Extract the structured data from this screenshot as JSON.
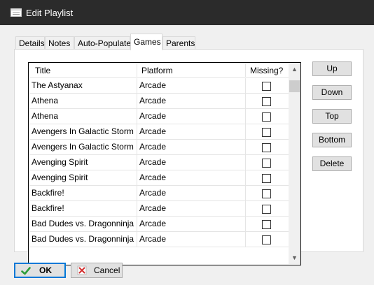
{
  "window": {
    "title": "Edit Playlist"
  },
  "tabs": [
    {
      "label": "Details"
    },
    {
      "label": "Notes"
    },
    {
      "label": "Auto-Populate"
    },
    {
      "label": "Games"
    },
    {
      "label": "Parents"
    }
  ],
  "active_tab": "Games",
  "games_table": {
    "columns": [
      "Title",
      "Platform",
      "Missing?"
    ],
    "rows": [
      {
        "title": "The Astyanax",
        "platform": "Arcade",
        "missing": false
      },
      {
        "title": "Athena",
        "platform": "Arcade",
        "missing": false
      },
      {
        "title": "Athena",
        "platform": "Arcade",
        "missing": false
      },
      {
        "title": "Avengers In Galactic Storm",
        "platform": "Arcade",
        "missing": false
      },
      {
        "title": "Avengers In Galactic Storm",
        "platform": "Arcade",
        "missing": false
      },
      {
        "title": "Avenging Spirit",
        "platform": "Arcade",
        "missing": false
      },
      {
        "title": "Avenging Spirit",
        "platform": "Arcade",
        "missing": false
      },
      {
        "title": "Backfire!",
        "platform": "Arcade",
        "missing": false
      },
      {
        "title": "Backfire!",
        "platform": "Arcade",
        "missing": false
      },
      {
        "title": "Bad Dudes vs. Dragonninja",
        "platform": "Arcade",
        "missing": false
      },
      {
        "title": "Bad Dudes vs. Dragonninja",
        "platform": "Arcade",
        "missing": false
      }
    ]
  },
  "side_buttons": {
    "up": "Up",
    "down": "Down",
    "top": "Top",
    "bottom": "Bottom",
    "delete": "Delete"
  },
  "footer": {
    "ok": "OK",
    "cancel": "Cancel"
  },
  "colors": {
    "titlebar": "#2b2b2b",
    "dialog": "#f0f0f0",
    "focus_border": "#0078d7",
    "ok_check": "#2e9e3a",
    "cancel_x": "#d32f2f"
  },
  "icons": {
    "window": "window-icon",
    "ok": "checkmark-icon",
    "cancel": "cancel-x-icon",
    "scroll_up": "scroll-up-arrow-icon",
    "scroll_down": "scroll-down-arrow-icon"
  }
}
